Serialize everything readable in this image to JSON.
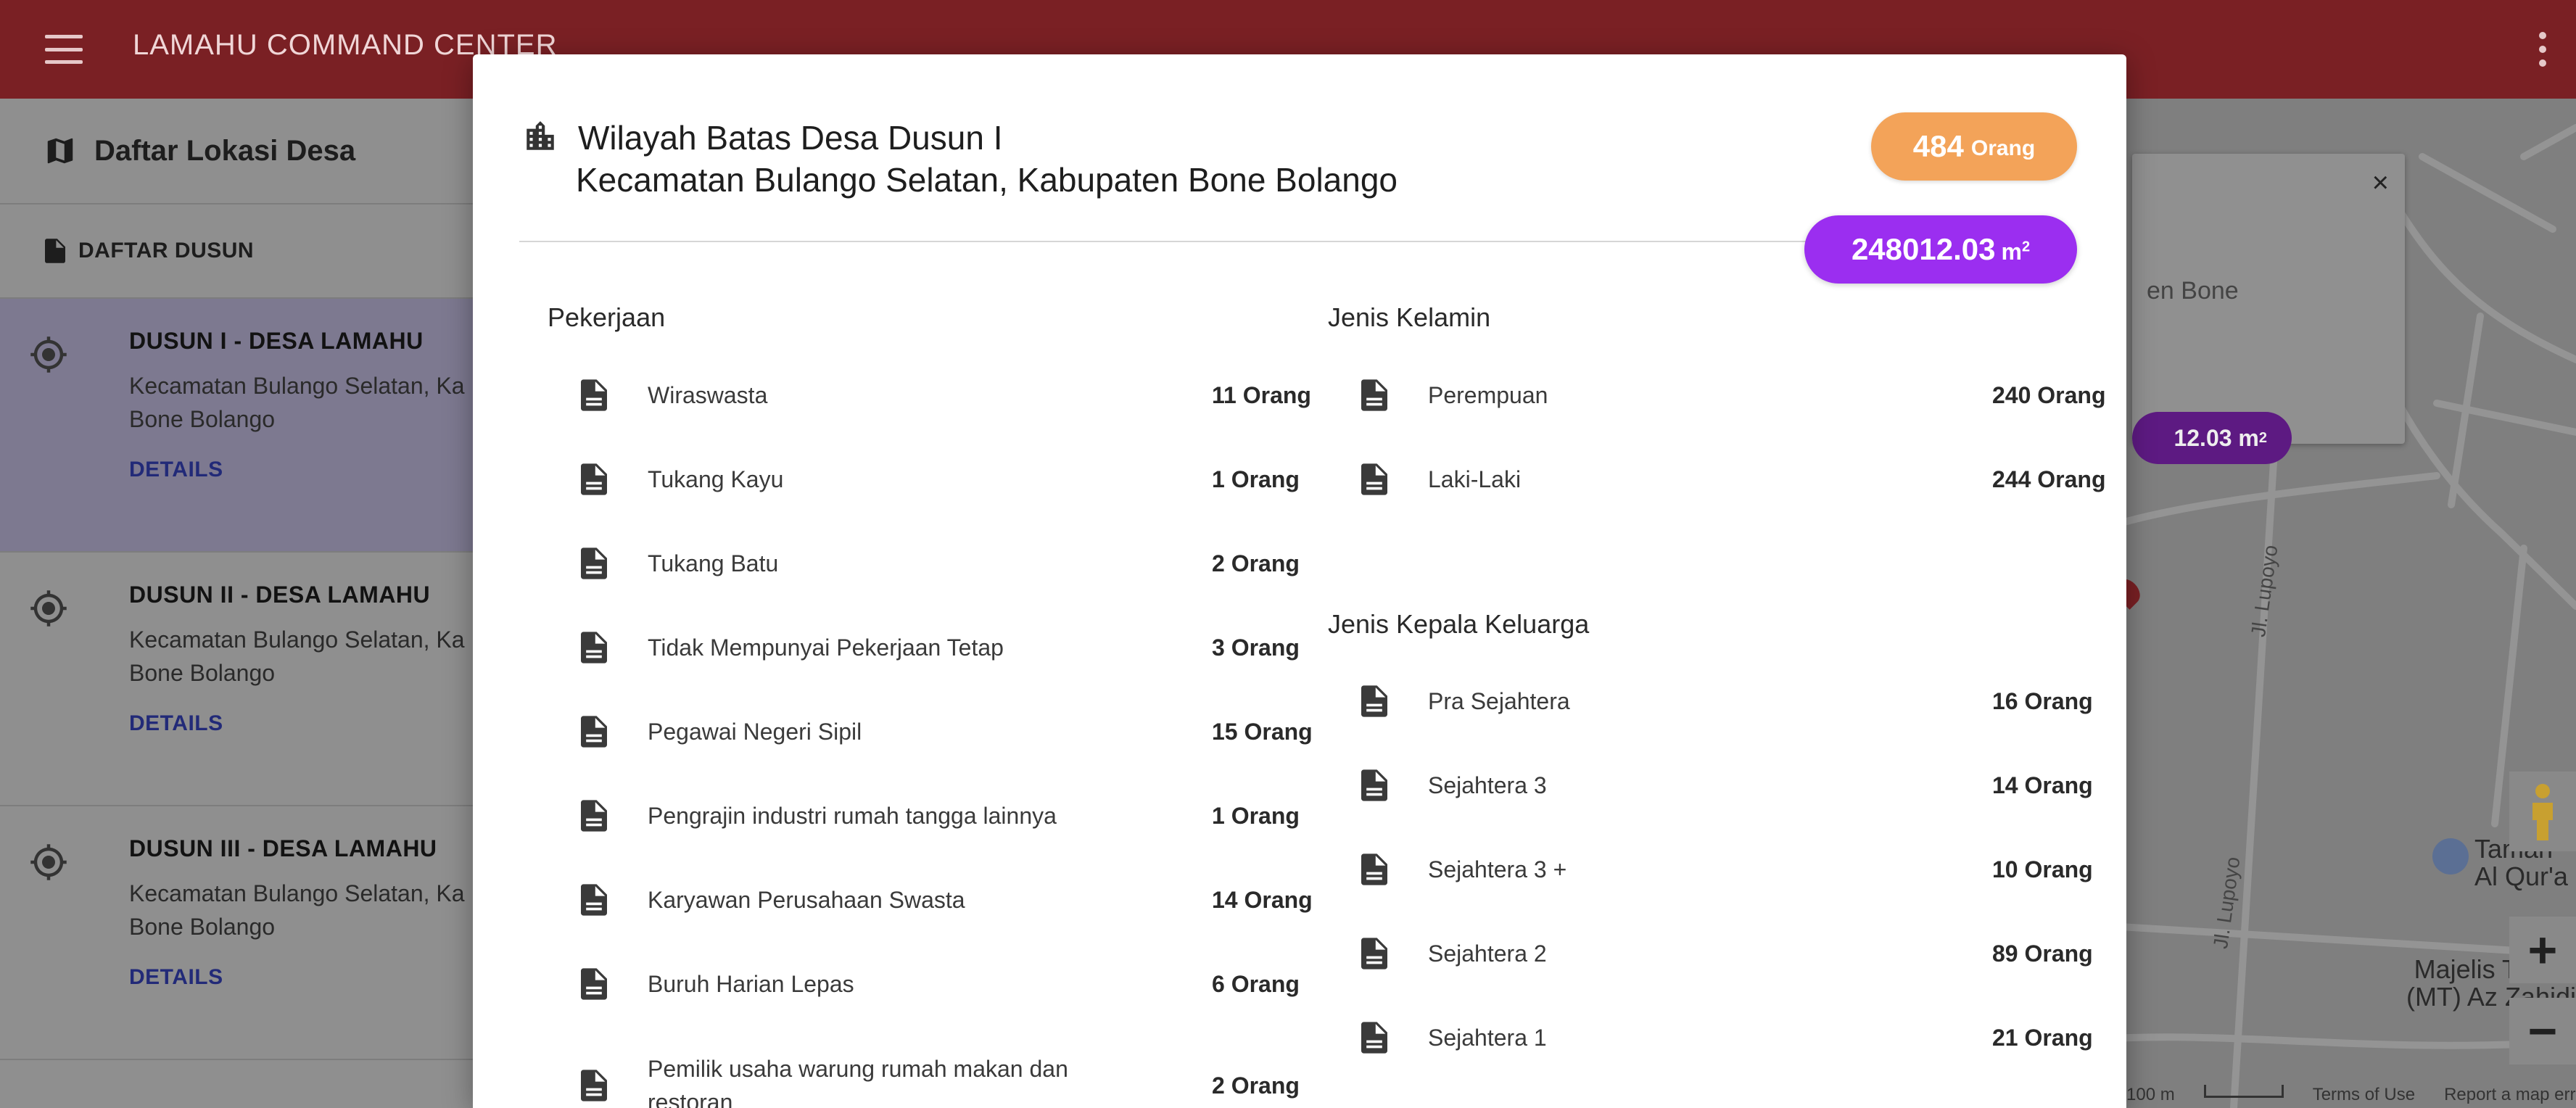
{
  "appbar": {
    "title": "LAMAHU COMMAND CENTER",
    "menu_icon": "hamburger-menu-icon",
    "more_icon": "more-vert-icon"
  },
  "sidebar": {
    "header": "Daftar Lokasi Desa",
    "subheader": "DAFTAR DUSUN",
    "items": [
      {
        "title": "DUSUN I - DESA LAMAHU",
        "line1": "Kecamatan Bulango Selatan, Ka",
        "line2": "Bone Bolango",
        "link": "DETAILS"
      },
      {
        "title": "DUSUN II - DESA LAMAHU",
        "line1": "Kecamatan Bulango Selatan, Ka",
        "line2": "Bone Bolango",
        "link": "DETAILS"
      },
      {
        "title": "DUSUN III - DESA LAMAHU",
        "line1": "Kecamatan Bulango Selatan, Ka",
        "line2": "Bone Bolango",
        "link": "DETAILS"
      }
    ]
  },
  "map": {
    "info_text": "en Bone",
    "info_pill": "12.03 m",
    "close": "×",
    "road1": "Jl. Lupoyo",
    "road2": "Jl. Lupoyo",
    "poi1_line1": "Taman",
    "poi1_line2": "Al Qur'a",
    "poi2_line1": "Majelis Taklim",
    "poi2_line2": "(MT) Az Zahidi",
    "scale": "100 m",
    "terms": "Terms of Use",
    "report": "Report a map err",
    "zoom_in": "+",
    "zoom_out": "−"
  },
  "modal": {
    "title": "Wilayah Batas Desa Dusun I",
    "subtitle": "Kecamatan Bulango Selatan, Kabupaten Bone Bolango",
    "population_value": "484",
    "population_unit": "Orang",
    "area_value": "248012.03",
    "area_unit": "m",
    "area_exp": "2",
    "pekerjaan": {
      "title": "Pekerjaan",
      "rows": [
        {
          "name": "Wiraswasta",
          "value": "11 Orang"
        },
        {
          "name": "Tukang Kayu",
          "value": "1 Orang"
        },
        {
          "name": "Tukang Batu",
          "value": "2 Orang"
        },
        {
          "name": "Tidak Mempunyai Pekerjaan Tetap",
          "value": "3 Orang"
        },
        {
          "name": "Pegawai Negeri Sipil",
          "value": "15 Orang"
        },
        {
          "name": "Pengrajin industri rumah tangga lainnya",
          "value": "1 Orang"
        },
        {
          "name": "Karyawan Perusahaan Swasta",
          "value": "14 Orang"
        },
        {
          "name": "Buruh Harian Lepas",
          "value": "6 Orang"
        },
        {
          "name": "Pemilik usaha warung rumah makan dan restoran",
          "value": "2 Orang"
        }
      ]
    },
    "jenis_kelamin": {
      "title": "Jenis Kelamin",
      "rows": [
        {
          "name": "Perempuan",
          "value": "240 Orang"
        },
        {
          "name": "Laki-Laki",
          "value": "244 Orang"
        }
      ]
    },
    "kepala_keluarga": {
      "title": "Jenis Kepala Keluarga",
      "rows": [
        {
          "name": "Pra Sejahtera",
          "value": "16 Orang"
        },
        {
          "name": "Sejahtera 3",
          "value": "14 Orang"
        },
        {
          "name": "Sejahtera 3 +",
          "value": "10 Orang"
        },
        {
          "name": "Sejahtera 2",
          "value": "89 Orang"
        },
        {
          "name": "Sejahtera 1",
          "value": "21 Orang"
        }
      ]
    }
  }
}
